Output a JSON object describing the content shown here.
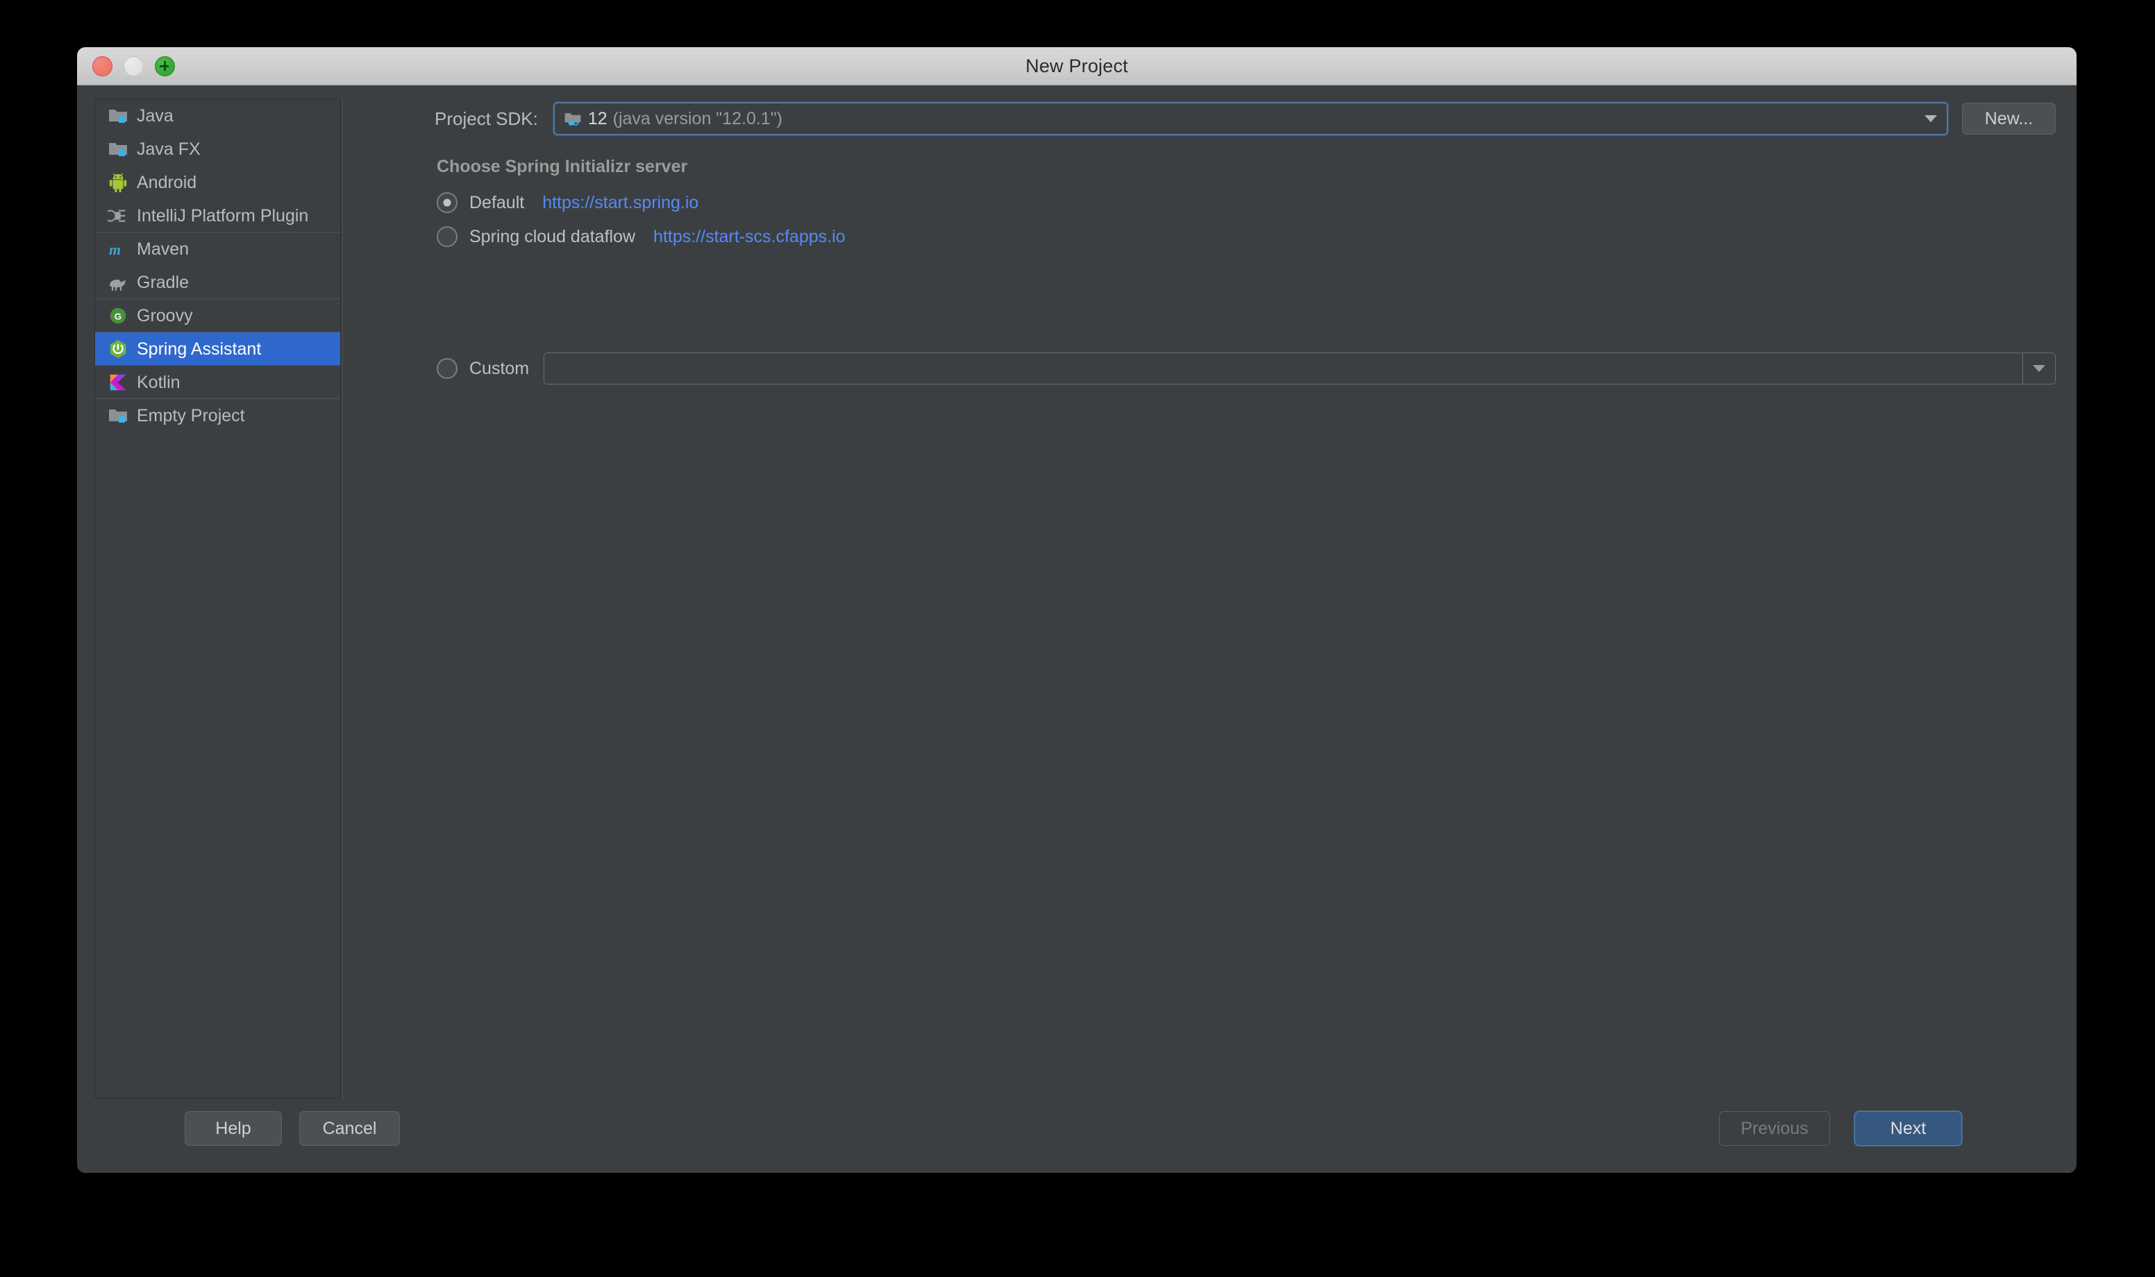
{
  "window": {
    "title": "New Project",
    "traffic_lights": [
      {
        "name": "close",
        "color": "#ec6a5e"
      },
      {
        "name": "minimize",
        "color": "#dcdcdc"
      },
      {
        "name": "zoom",
        "color": "#27a327"
      }
    ]
  },
  "sidebar": {
    "items": [
      {
        "label": "Java",
        "icon": "folder-java-icon",
        "selected": false,
        "separator_after": false
      },
      {
        "label": "Java FX",
        "icon": "folder-javafx-icon",
        "selected": false,
        "separator_after": false
      },
      {
        "label": "Android",
        "icon": "android-icon",
        "selected": false,
        "separator_after": false
      },
      {
        "label": "IntelliJ Platform Plugin",
        "icon": "plugin-icon",
        "selected": false,
        "separator_after": true
      },
      {
        "label": "Maven",
        "icon": "maven-icon",
        "selected": false,
        "separator_after": false
      },
      {
        "label": "Gradle",
        "icon": "gradle-icon",
        "selected": false,
        "separator_after": true
      },
      {
        "label": "Groovy",
        "icon": "groovy-icon",
        "selected": false,
        "separator_after": true
      },
      {
        "label": "Spring Assistant",
        "icon": "spring-icon",
        "selected": true,
        "separator_after": true
      },
      {
        "label": "Kotlin",
        "icon": "kotlin-icon",
        "selected": false,
        "separator_after": true
      },
      {
        "label": "Empty Project",
        "icon": "folder-empty-icon",
        "selected": false,
        "separator_after": false
      }
    ],
    "selection_color": "#2f68cd"
  },
  "main": {
    "sdk": {
      "label": "Project SDK:",
      "value_version": "12",
      "value_detail": "(java version \"12.0.1\")",
      "icon": "jdk-folder-icon",
      "dropdown_icon": "chevron-down-icon",
      "new_button": "New...",
      "focus_color": "#4b7ba8"
    },
    "section_title": "Choose Spring Initializr server",
    "servers": [
      {
        "id": "default",
        "label": "Default",
        "url": "https://start.spring.io",
        "selected": true
      },
      {
        "id": "dataflow",
        "label": "Spring cloud dataflow",
        "url": "https://start-scs.cfapps.io",
        "selected": false
      },
      {
        "id": "custom",
        "label": "Custom",
        "url": "",
        "selected": false
      }
    ],
    "custom_input": {
      "value": "",
      "placeholder": "",
      "dropdown_icon": "chevron-down-icon"
    },
    "link_color": "#548af7"
  },
  "footer": {
    "help_label": "Help",
    "cancel_label": "Cancel",
    "previous_label": "Previous",
    "previous_disabled": true,
    "next_label": "Next",
    "next_default_color": "#365880"
  }
}
